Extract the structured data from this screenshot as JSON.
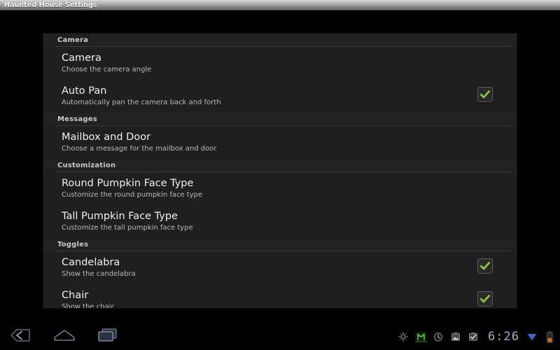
{
  "window": {
    "title": "Haunted House Settings"
  },
  "settings": {
    "sections": [
      {
        "header": "Camera",
        "items": [
          {
            "title": "Camera",
            "summary": "Choose the camera angle",
            "widget": "none",
            "checked": false
          },
          {
            "title": "Auto Pan",
            "summary": "Automatically pan the camera back and forth",
            "widget": "checkbox",
            "checked": true
          }
        ]
      },
      {
        "header": "Messages",
        "items": [
          {
            "title": "Mailbox and Door",
            "summary": "Choose a message for the mailbox and door",
            "widget": "none",
            "checked": false
          }
        ]
      },
      {
        "header": "Customization",
        "items": [
          {
            "title": "Round Pumpkin Face Type",
            "summary": "Customize the round pumpkin face type",
            "widget": "none",
            "checked": false
          },
          {
            "title": "Tall Pumpkin Face Type",
            "summary": "Customize the tall pumpkin face type",
            "widget": "none",
            "checked": false
          }
        ]
      },
      {
        "header": "Toggles",
        "items": [
          {
            "title": "Candelabra",
            "summary": "Show the candelabra",
            "widget": "checkbox",
            "checked": true
          },
          {
            "title": "Chair",
            "summary": "Show the chair",
            "widget": "checkbox",
            "checked": true
          }
        ]
      }
    ]
  },
  "system_bar": {
    "nav": [
      {
        "name": "back-icon",
        "label": "Back"
      },
      {
        "name": "home-icon",
        "label": "Home"
      },
      {
        "name": "recents-icon",
        "label": "Recent apps"
      }
    ],
    "notifications": [
      {
        "name": "usb-debug-icon",
        "label": "USB debugging connected"
      },
      {
        "name": "sync-icon",
        "label": "Sync active"
      },
      {
        "name": "alarm-icon",
        "label": "Alarm set"
      },
      {
        "name": "downloads-icon",
        "label": "Download complete"
      },
      {
        "name": "tasks-icon",
        "label": "Tasks"
      }
    ],
    "clock": "6:26",
    "wifi": {
      "name": "wifi-icon",
      "label": "Wi-Fi connected"
    },
    "battery": {
      "name": "battery-icon",
      "label": "Battery charging"
    }
  },
  "colors": {
    "accent_green": "#8cc63f",
    "panel_bg": "#1f1f22",
    "screen_bg": "#000000",
    "clock_blue": "#9fb4cc",
    "wifi_blue": "#3a66cc",
    "battery_orange": "#d4701a"
  }
}
